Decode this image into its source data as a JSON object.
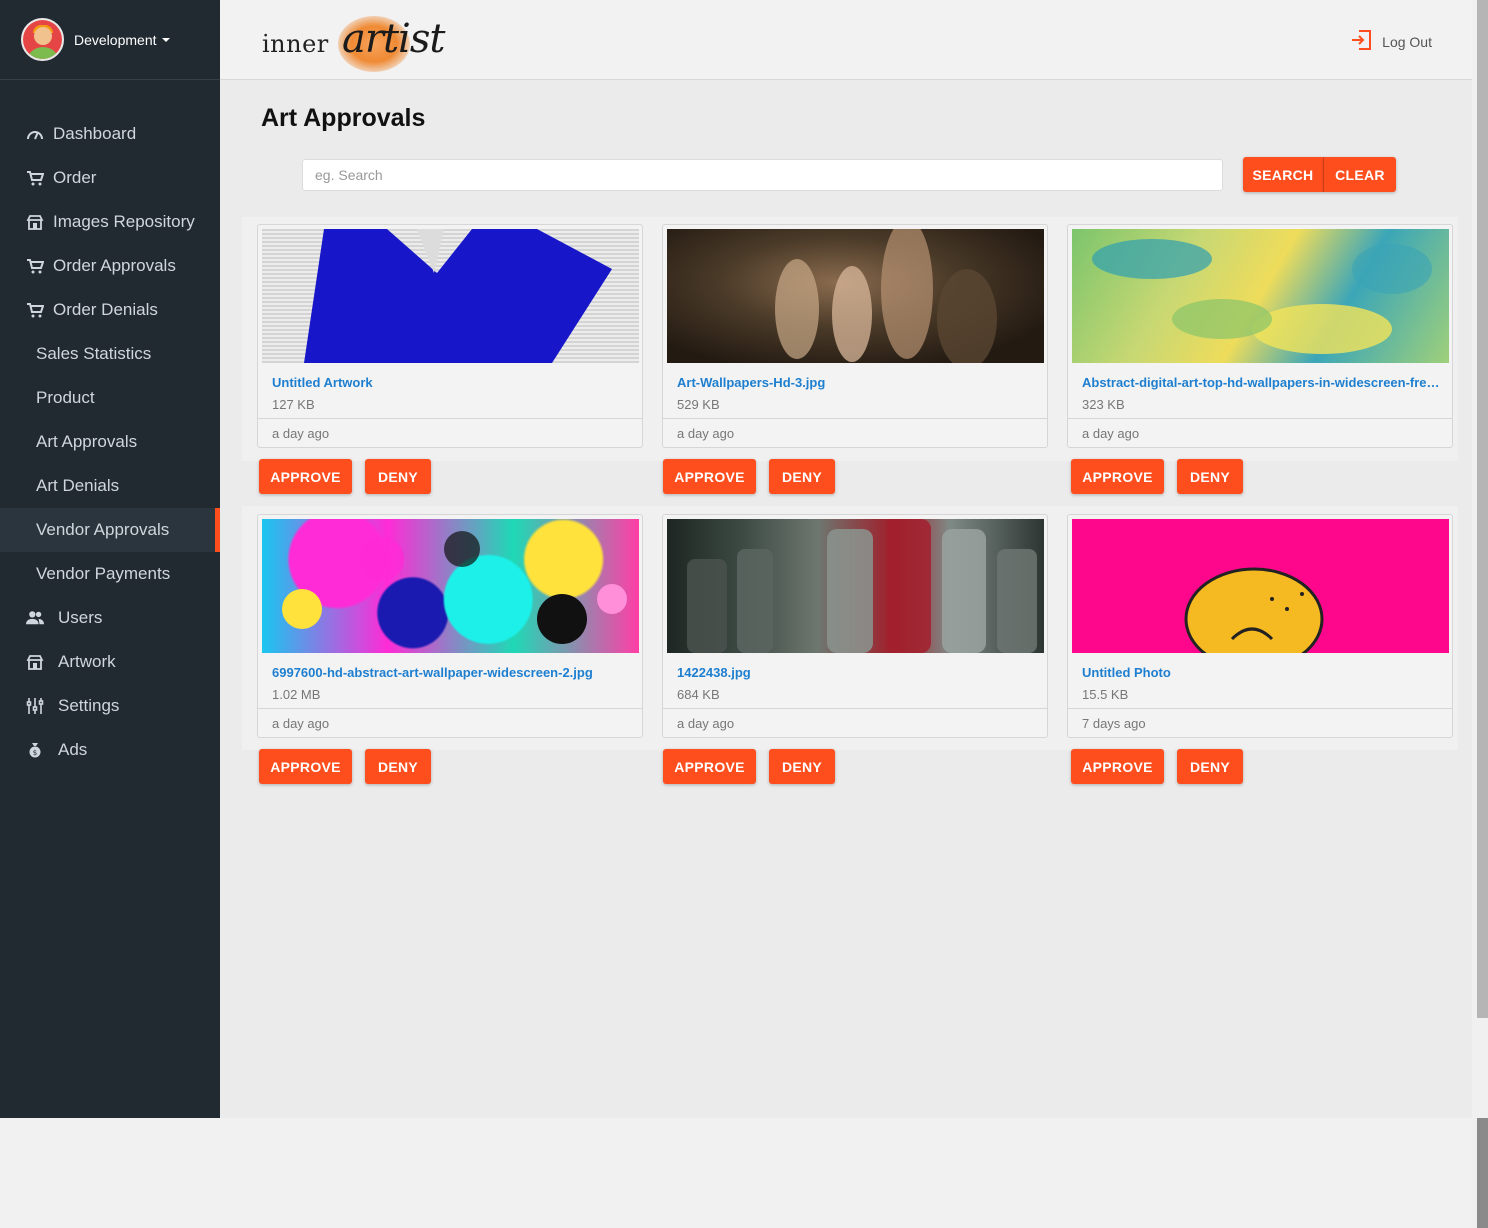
{
  "profile": {
    "name": "Development"
  },
  "sidebar": {
    "items": [
      {
        "label": "Dashboard",
        "icon": "dashboard-gauge-icon"
      },
      {
        "label": "Order",
        "icon": "cart-icon"
      },
      {
        "label": "Images Repository",
        "icon": "storefront-icon"
      },
      {
        "label": "Order Approvals",
        "icon": "cart-icon"
      },
      {
        "label": "Order Denials",
        "icon": "cart-icon"
      },
      {
        "label": "Sales Statistics"
      },
      {
        "label": "Product"
      },
      {
        "label": "Art Approvals"
      },
      {
        "label": "Art Denials"
      },
      {
        "label": "Vendor Approvals",
        "active": true
      },
      {
        "label": "Vendor Payments"
      },
      {
        "label": "Users",
        "icon": "users-icon"
      },
      {
        "label": "Artwork",
        "icon": "storefront-icon"
      },
      {
        "label": "Settings",
        "icon": "sliders-icon"
      },
      {
        "label": "Ads",
        "icon": "money-bag-icon"
      }
    ]
  },
  "header": {
    "logo_inner": "inner",
    "logo_artist": "artist",
    "logout_label": "Log Out"
  },
  "main": {
    "title": "Art Approvals",
    "search_placeholder": "eg. Search",
    "search_label": "SEARCH",
    "clear_label": "CLEAR",
    "approve_label": "APPROVE",
    "deny_label": "DENY",
    "cards": [
      {
        "title": "Untitled Artwork",
        "size": "127 KB",
        "time": "a day ago"
      },
      {
        "title": "Art-Wallpapers-Hd-3.jpg",
        "size": "529 KB",
        "time": "a day ago"
      },
      {
        "title": "Abstract-digital-art-top-hd-wallpapers-in-widescreen-free-...",
        "size": "323 KB",
        "time": "a day ago"
      },
      {
        "title": "6997600-hd-abstract-art-wallpaper-widescreen-2.jpg",
        "size": "1.02 MB",
        "time": "a day ago"
      },
      {
        "title": "1422438.jpg",
        "size": "684 KB",
        "time": "a day ago"
      },
      {
        "title": "Untitled Photo",
        "size": "15.5 KB",
        "time": "7 days ago"
      }
    ]
  },
  "colors": {
    "accent": "#ff4e1e",
    "sidebar": "#212a31",
    "link": "#1e7fd0"
  }
}
